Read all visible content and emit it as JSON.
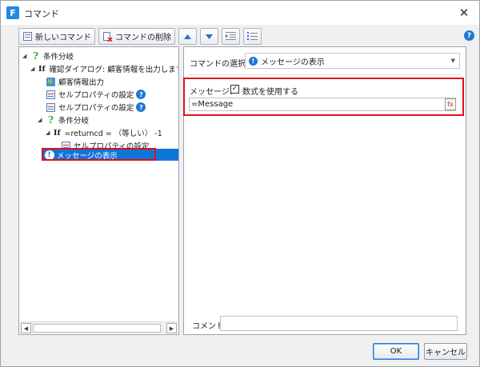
{
  "window": {
    "title": "コマンド",
    "app_icon": "F"
  },
  "toolbar": {
    "new_label": "新しいコマンド",
    "delete_label": "コマンドの削除"
  },
  "tree": {
    "items": [
      {
        "label": "条件分岐",
        "icon": "question-icon",
        "depth": 0
      },
      {
        "keyword": "If",
        "label": "確認ダイアログ: 顧客情報を出力します。よろ",
        "depth": 1
      },
      {
        "label": "顧客情報出力",
        "icon": "export-icon",
        "depth": 2
      },
      {
        "label": "セルプロパティの設定",
        "icon": "cell-property-icon",
        "depth": 2,
        "help": true
      },
      {
        "label": "セルプロパティの設定",
        "icon": "cell-property-icon",
        "depth": 2,
        "help": true
      },
      {
        "label": "条件分岐",
        "icon": "question-icon",
        "depth": 1
      },
      {
        "keyword": "If",
        "label": "=returncd = （等しい） -1",
        "depth": 2
      },
      {
        "label": "セルプロパティの設定",
        "icon": "cell-property-icon",
        "depth": 3
      },
      {
        "label": "メッセージの表示",
        "icon": "info-icon",
        "depth": 1,
        "selected": true
      }
    ]
  },
  "command": {
    "select_label": "コマンドの選択：",
    "selected_value": "メッセージの表示",
    "message_label": "メッセージ：",
    "use_formula_label": "数式を使用する",
    "use_formula_checked": true,
    "check_mark": "✓",
    "message_value": "=Message",
    "comment_label": "コメント",
    "comment_value": ""
  },
  "footer": {
    "ok_label": "OK",
    "cancel_label": "キャンセル"
  },
  "colors": {
    "selection": "#0e75d8",
    "highlight_box": "#e0101a",
    "help": "#1e78d2"
  }
}
